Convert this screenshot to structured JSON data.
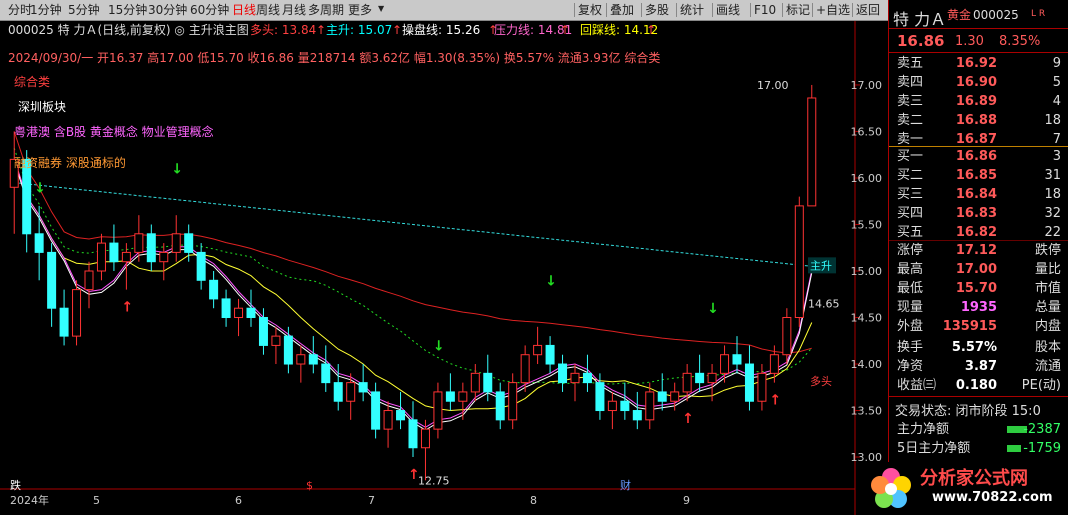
{
  "toolbar": {
    "left": [
      "分时",
      "1分钟",
      "5分钟",
      "15分钟",
      "30分钟",
      "60分钟",
      "日线",
      "周线",
      "月线",
      "多周期",
      "更多"
    ],
    "right": [
      "复权",
      "叠加",
      "多股",
      "统计",
      "画线",
      "F10",
      "标记",
      "+自选",
      "返回"
    ]
  },
  "header": {
    "stock_line": "000025 特 力Ａ(日线,前复权) ◎ 主升浪主图",
    "indicators": [
      {
        "label": "多头: 13.84",
        "color": "#ff4040"
      },
      {
        "label": "主升: 15.07",
        "color": "#00ffff"
      },
      {
        "label": "操盘线: 15.26",
        "color": "#ffffff"
      },
      {
        "label": "压力线: 14.81",
        "color": "#ff66cc"
      },
      {
        "label": "回踩线: 14.12",
        "color": "#ffff00"
      }
    ],
    "info_line": "2024/09/30/一  开16.37 高17.00 低15.70 收16.86 量218714 额3.62亿 幅1.30(8.35%) 换5.57% 流通3.93亿 综合类",
    "sectors": [
      "综合类",
      "深圳板块",
      "粤港澳 含B股 黄金概念 物业管理概念",
      "融资融券 深股通标的"
    ]
  },
  "chart_data": {
    "type": "candlestick",
    "y_ticks": [
      "17.00",
      "16.50",
      "16.00",
      "15.50",
      "15.00",
      "14.50",
      "14.00",
      "13.50",
      "13.00"
    ],
    "ylim": [
      12.85,
      17.15
    ],
    "x_labels": [
      "2024年",
      "5",
      "6",
      "7",
      "8",
      "9"
    ],
    "annotations": [
      "17.00",
      "12.75",
      "14.65",
      "主升",
      "多头"
    ],
    "markers": [
      "跌",
      "$",
      "财"
    ],
    "candles": [
      [
        15.9,
        16.5,
        15.4,
        16.2
      ],
      [
        16.2,
        16.3,
        15.2,
        15.4
      ],
      [
        15.4,
        15.7,
        14.9,
        15.2
      ],
      [
        15.2,
        15.3,
        14.4,
        14.6
      ],
      [
        14.6,
        14.8,
        14.2,
        14.3
      ],
      [
        14.3,
        14.9,
        14.2,
        14.8
      ],
      [
        14.8,
        15.1,
        14.6,
        15.0
      ],
      [
        15.0,
        15.4,
        14.9,
        15.3
      ],
      [
        15.3,
        15.5,
        15.0,
        15.1
      ],
      [
        15.1,
        15.3,
        14.8,
        15.2
      ],
      [
        15.2,
        15.6,
        15.1,
        15.4
      ],
      [
        15.4,
        15.5,
        15.0,
        15.1
      ],
      [
        15.1,
        15.3,
        14.9,
        15.2
      ],
      [
        15.2,
        15.6,
        15.1,
        15.4
      ],
      [
        15.4,
        15.5,
        15.1,
        15.2
      ],
      [
        15.2,
        15.3,
        14.8,
        14.9
      ],
      [
        14.9,
        15.0,
        14.6,
        14.7
      ],
      [
        14.7,
        14.8,
        14.4,
        14.5
      ],
      [
        14.5,
        14.7,
        14.3,
        14.6
      ],
      [
        14.6,
        14.8,
        14.4,
        14.5
      ],
      [
        14.5,
        14.6,
        14.1,
        14.2
      ],
      [
        14.2,
        14.4,
        14.0,
        14.3
      ],
      [
        14.3,
        14.4,
        13.9,
        14.0
      ],
      [
        14.0,
        14.2,
        13.8,
        14.1
      ],
      [
        14.1,
        14.3,
        13.9,
        14.0
      ],
      [
        14.0,
        14.2,
        13.7,
        13.8
      ],
      [
        13.8,
        14.0,
        13.5,
        13.6
      ],
      [
        13.6,
        13.9,
        13.4,
        13.8
      ],
      [
        13.8,
        14.0,
        13.6,
        13.7
      ],
      [
        13.7,
        13.8,
        13.2,
        13.3
      ],
      [
        13.3,
        13.6,
        13.1,
        13.5
      ],
      [
        13.5,
        13.7,
        13.3,
        13.4
      ],
      [
        13.4,
        13.6,
        13.0,
        13.1
      ],
      [
        13.1,
        13.4,
        12.75,
        13.3
      ],
      [
        13.3,
        13.8,
        13.2,
        13.7
      ],
      [
        13.7,
        13.9,
        13.5,
        13.6
      ],
      [
        13.6,
        13.8,
        13.4,
        13.7
      ],
      [
        13.7,
        14.0,
        13.6,
        13.9
      ],
      [
        13.9,
        14.1,
        13.6,
        13.7
      ],
      [
        13.7,
        13.8,
        13.3,
        13.4
      ],
      [
        13.4,
        13.9,
        13.3,
        13.8
      ],
      [
        13.8,
        14.2,
        13.7,
        14.1
      ],
      [
        14.1,
        14.4,
        14.0,
        14.2
      ],
      [
        14.2,
        14.3,
        13.9,
        14.0
      ],
      [
        14.0,
        14.1,
        13.7,
        13.8
      ],
      [
        13.8,
        14.0,
        13.6,
        13.9
      ],
      [
        13.9,
        14.1,
        13.7,
        13.8
      ],
      [
        13.8,
        13.9,
        13.4,
        13.5
      ],
      [
        13.5,
        13.7,
        13.3,
        13.6
      ],
      [
        13.6,
        13.8,
        13.4,
        13.5
      ],
      [
        13.5,
        13.7,
        13.3,
        13.4
      ],
      [
        13.4,
        13.8,
        13.3,
        13.7
      ],
      [
        13.7,
        13.9,
        13.5,
        13.6
      ],
      [
        13.6,
        13.8,
        13.5,
        13.7
      ],
      [
        13.7,
        14.0,
        13.6,
        13.9
      ],
      [
        13.9,
        14.1,
        13.7,
        13.8
      ],
      [
        13.8,
        14.0,
        13.6,
        13.9
      ],
      [
        13.9,
        14.2,
        13.8,
        14.1
      ],
      [
        14.1,
        14.3,
        13.9,
        14.0
      ],
      [
        14.0,
        14.2,
        13.5,
        13.6
      ],
      [
        13.6,
        14.0,
        13.5,
        13.9
      ],
      [
        13.9,
        14.2,
        13.8,
        14.1
      ],
      [
        14.1,
        14.6,
        14.0,
        14.5
      ],
      [
        14.5,
        15.8,
        14.4,
        15.7
      ],
      [
        15.7,
        17.0,
        15.7,
        16.86
      ]
    ]
  },
  "quote": {
    "name": "特 力Ａ",
    "tag": "黄金",
    "code": "000025",
    "flags": "L R",
    "price": "16.86",
    "change": "1.30",
    "pct": "8.35%",
    "asks": [
      [
        "卖五",
        "16.92",
        "9"
      ],
      [
        "卖四",
        "16.90",
        "5"
      ],
      [
        "卖三",
        "16.89",
        "4"
      ],
      [
        "卖二",
        "16.88",
        "18"
      ],
      [
        "卖一",
        "16.87",
        "7"
      ]
    ],
    "bids": [
      [
        "买一",
        "16.86",
        "3"
      ],
      [
        "买二",
        "16.85",
        "31"
      ],
      [
        "买三",
        "16.84",
        "18"
      ],
      [
        "买四",
        "16.83",
        "32"
      ],
      [
        "买五",
        "16.82",
        "22"
      ]
    ],
    "stats": [
      [
        "涨停",
        "17.12",
        "跌停"
      ],
      [
        "最高",
        "17.00",
        "量比"
      ],
      [
        "最低",
        "15.70",
        "市值"
      ],
      [
        "现量",
        "1935",
        "总量"
      ],
      [
        "外盘",
        "135915",
        "内盘"
      ]
    ],
    "stats2": [
      [
        "换手",
        "5.57%",
        "股本"
      ],
      [
        "净资",
        "3.87",
        "流通"
      ],
      [
        "收益㈢",
        "0.180",
        "PE(动)"
      ]
    ],
    "state": "交易状态: 闭市阶段 15:0",
    "flow": [
      [
        "主力净额",
        "-2387"
      ],
      [
        "5日主力净额",
        "-1759"
      ]
    ]
  },
  "logo": {
    "title": "分析家公式网",
    "url": "www.70822.com"
  }
}
